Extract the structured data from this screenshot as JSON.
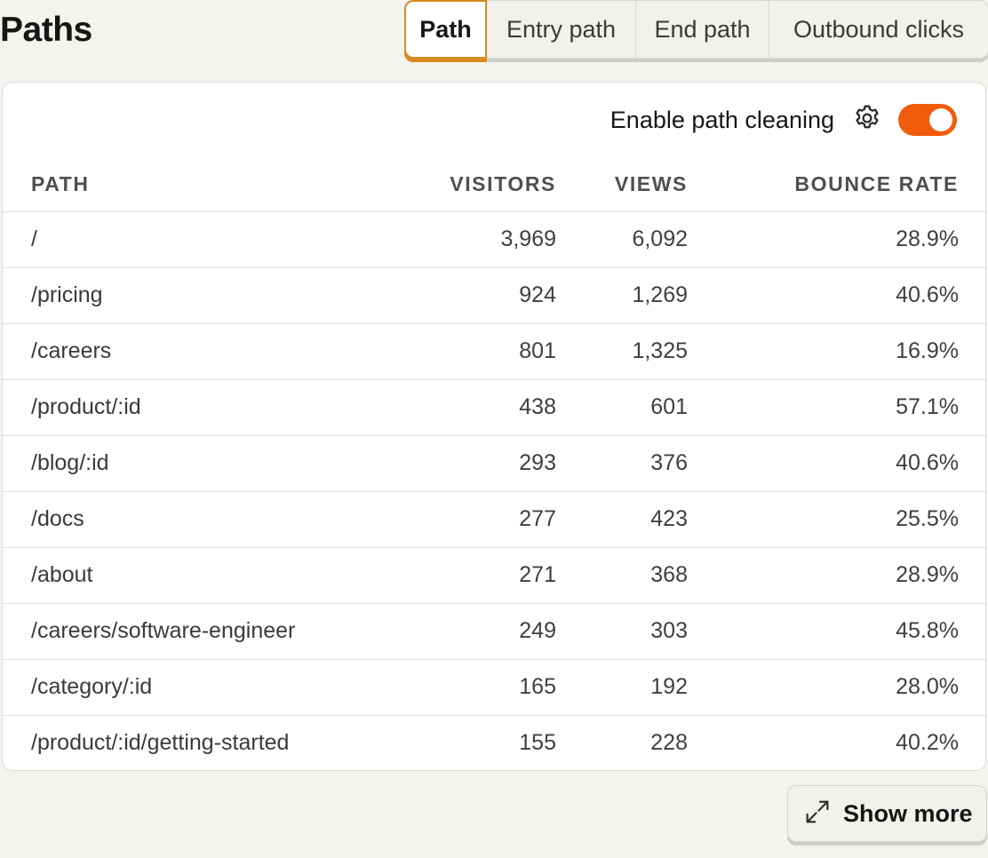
{
  "title": "Paths",
  "tabs": [
    {
      "label": "Path",
      "active": true
    },
    {
      "label": "Entry path",
      "active": false
    },
    {
      "label": "End path",
      "active": false
    },
    {
      "label": "Outbound clicks",
      "active": false
    }
  ],
  "path_cleaning": {
    "label": "Enable path cleaning",
    "enabled": true,
    "settings_icon": "gear-icon"
  },
  "table": {
    "headers": {
      "path": "PATH",
      "visitors": "VISITORS",
      "views": "VIEWS",
      "bounce_rate": "BOUNCE RATE"
    },
    "rows": [
      {
        "path": "/",
        "visitors": "3,969",
        "views": "6,092",
        "bounce_rate": "28.9%"
      },
      {
        "path": "/pricing",
        "visitors": "924",
        "views": "1,269",
        "bounce_rate": "40.6%"
      },
      {
        "path": "/careers",
        "visitors": "801",
        "views": "1,325",
        "bounce_rate": "16.9%"
      },
      {
        "path": "/product/:id",
        "visitors": "438",
        "views": "601",
        "bounce_rate": "57.1%"
      },
      {
        "path": "/blog/:id",
        "visitors": "293",
        "views": "376",
        "bounce_rate": "40.6%"
      },
      {
        "path": "/docs",
        "visitors": "277",
        "views": "423",
        "bounce_rate": "25.5%"
      },
      {
        "path": "/about",
        "visitors": "271",
        "views": "368",
        "bounce_rate": "28.9%"
      },
      {
        "path": "/careers/software-engineer",
        "visitors": "249",
        "views": "303",
        "bounce_rate": "45.8%"
      },
      {
        "path": "/category/:id",
        "visitors": "165",
        "views": "192",
        "bounce_rate": "28.0%"
      },
      {
        "path": "/product/:id/getting-started",
        "visitors": "155",
        "views": "228",
        "bounce_rate": "40.2%"
      }
    ]
  },
  "show_more": {
    "label": "Show more",
    "icon": "expand-icon"
  },
  "colors": {
    "accent": "#f25a0c",
    "tab_active_border": "#d98a1e"
  }
}
